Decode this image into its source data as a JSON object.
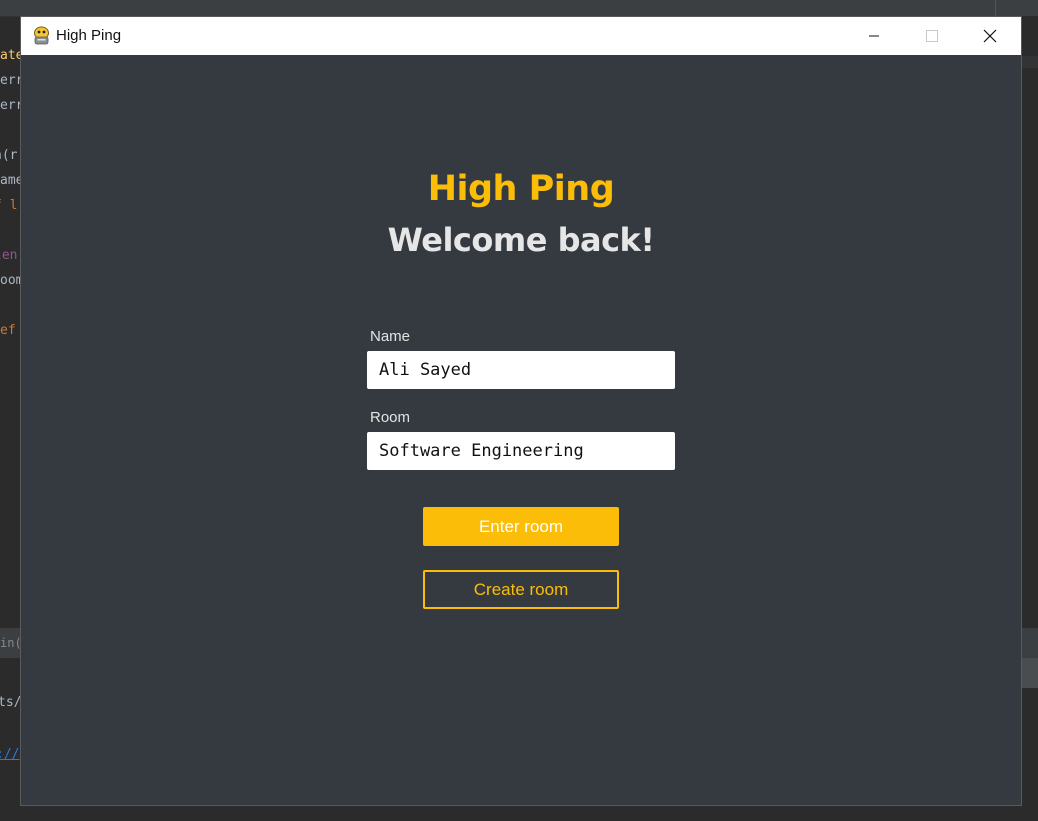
{
  "window": {
    "title": "High Ping",
    "icon": "pygame-snake-icon"
  },
  "colors": {
    "accent": "#fbbd08",
    "background": "#353a41",
    "heading": "#e6e6e6"
  },
  "main": {
    "app_name": "High Ping",
    "greeting": "Welcome back!"
  },
  "form": {
    "name_label": "Name",
    "name_value": "Ali Sayed",
    "room_label": "Room",
    "room_value": "Software Engineering",
    "enter_label": "Enter room",
    "create_label": "Create room"
  },
  "background_ide": {
    "fragments": [
      "ate",
      "err",
      "err",
      "n(r",
      "ame",
      "f l",
      "len",
      "oom",
      "ef",
      "in()",
      "ts/",
      "://"
    ]
  }
}
